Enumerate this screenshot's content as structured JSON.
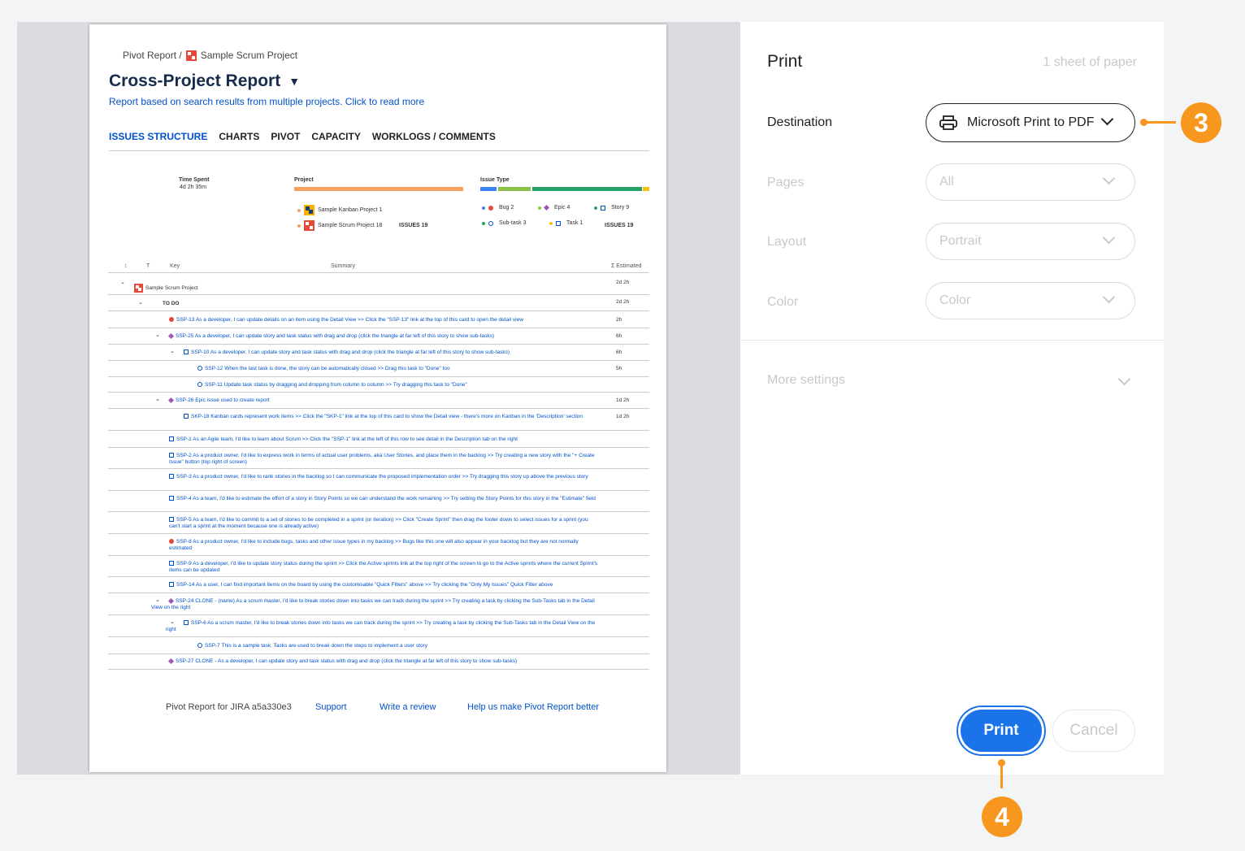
{
  "report": {
    "breadcrumb_root": "Pivot Report /",
    "breadcrumb_project": "Sample Scrum Project",
    "title": "Cross-Project Report",
    "subtitle": "Report based on search results from multiple projects. Click to read more",
    "tabs": [
      "ISSUES STRUCTURE",
      "CHARTS",
      "PIVOT",
      "CAPACITY",
      "WORKLOGS / COMMENTS"
    ],
    "summary": {
      "time_spent_label": "Time Spent",
      "time_spent_value": "4d 2h 35m",
      "project_label": "Project",
      "issue_type_label": "Issue Type",
      "projects": [
        "Sample Kanban Project 1",
        "Sample Scrum Project 18"
      ],
      "projects_issues": "ISSUES 19",
      "issue_types": [
        "Bug 2",
        "Epic 4",
        "Story 9",
        "Sub-task 3",
        "Task 1"
      ],
      "types_issues": "ISSUES 19"
    },
    "table_headers": {
      "sort": "↕",
      "type": "T",
      "key": "Key",
      "summary": "Summary",
      "estimated": "Σ Estimated"
    },
    "rows": [
      {
        "text": "Sample Scrum Project",
        "est": "2d 2h"
      },
      {
        "text": "TO DO",
        "est": "2d 2h"
      },
      {
        "text": "SSP-13 As a developer, I can update details on an item using the Detail View >> Click the \"SSP-13\" link at the top of this card to open the detail view",
        "est": "2h"
      },
      {
        "text": "SSP-25 As a developer, I can update story and task status with drag and drop (click the triangle at far left of this story to show sub-tasks)",
        "est": "6h"
      },
      {
        "text": "SSP-10 As a developer, I can update story and task status with drag and drop (click the triangle at far left of this story to show sub-tasks)",
        "est": "6h"
      },
      {
        "text": "SSP-12 When the last task is done, the story can be automatically closed >> Drag this task to \"Done\" too",
        "est": "5h"
      },
      {
        "text": "SSP-11 Update task status by dragging and dropping from column to column >> Try dragging this task to \"Done\"",
        "est": ""
      },
      {
        "text": "SSP-26 Epic issue used to create report",
        "est": "1d 2h"
      },
      {
        "text": "SKP-18 Kanban cards represent work items >> Click the \"SKP-1\" link at the top of this card to show the Detail view - there's more on Kanban in the 'Description' section",
        "est": "1d 2h"
      },
      {
        "text": "SSP-1 As an Agile team, I'd like to learn about Scrum >> Click the \"SSP-1\" link at the left of this row to see detail in the Description tab on the right",
        "est": ""
      },
      {
        "text": "SSP-2 As a product owner, I'd like to express work in terms of actual user problems, aka User Stories, and place them in the backlog >> Try creating a new story with the \"+ Create Issue\" button (top right of screen)",
        "est": ""
      },
      {
        "text": "SSP-3 As a product owner, I'd like to rank stories in the backlog so I can communicate the proposed implementation order >> Try dragging this story up above the previous story",
        "est": ""
      },
      {
        "text": "SSP-4 As a team, I'd like to estimate the effort of a story in Story Points so we can understand the work remaining >> Try setting the Story Points for this story in the \"Estimate\" field",
        "est": ""
      },
      {
        "text": "SSP-5 As a team, I'd like to commit to a set of stories to be completed in a sprint (or iteration) >> Click \"Create Sprint\" then drag the footer down to select issues for a sprint (you can't start a sprint at the moment because one is already active)",
        "est": ""
      },
      {
        "text": "SSP-8 As a product owner, I'd like to include bugs, tasks and other issue types in my backlog >> Bugs like this one will also appear in your backlog but they are not normally estimated",
        "est": ""
      },
      {
        "text": "SSP-9 As a developer, I'd like to update story status during the sprint >> Click the Active sprints link at the top right of the screen to go to the Active sprints where the current Sprint's items can be updated",
        "est": ""
      },
      {
        "text": "SSP-14 As a user, I can find important items on the board by using the customisable \"Quick Filters\" above >> Try clicking the \"Only My Issues\" Quick Filter above",
        "est": ""
      },
      {
        "text": "SSP-24 CLONE - (name) As a scrum master, I'd like to break stories down into tasks we can track during the sprint >> Try creating a task by clicking the Sub-Tasks tab in the Detail View on the right",
        "est": ""
      },
      {
        "text": "SSP-6 As a scrum master, I'd like to break stories down into tasks we can track during the sprint >> Try creating a task by clicking the Sub-Tasks tab in the Detail View on the right",
        "est": ""
      },
      {
        "text": "SSP-7 This is a sample task. Tasks are used to break down the steps to implement a user story",
        "est": ""
      },
      {
        "text": "SSP-27 CLONE - As a developer, I can update story and task status with drag and drop (click the triangle at far left of this story to show sub-tasks)",
        "est": ""
      }
    ],
    "footer": [
      "Pivot Report for JIRA a5a330e3",
      "Support",
      "Write a review",
      "Help us make Pivot Report better"
    ]
  },
  "print": {
    "title": "Print",
    "sheets": "1 sheet of paper",
    "destination_label": "Destination",
    "destination_value": "Microsoft Print to PDF",
    "pages_label": "Pages",
    "pages_value": "All",
    "layout_label": "Layout",
    "layout_value": "Portrait",
    "color_label": "Color",
    "color_value": "Color",
    "more_settings": "More settings",
    "print_button": "Print",
    "cancel_button": "Cancel"
  },
  "callouts": {
    "destination_step": "3",
    "print_step": "4"
  },
  "colors": {
    "accent": "#1a73e8",
    "callout": "#f7971e",
    "link": "#0052cc"
  }
}
